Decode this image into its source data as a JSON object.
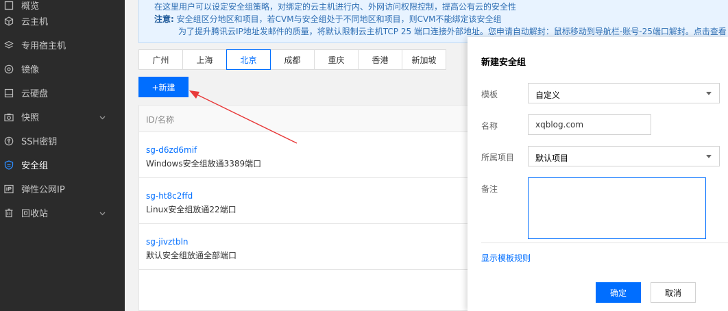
{
  "sidebar": {
    "items": [
      {
        "label": "概览",
        "icon": "overview-icon"
      },
      {
        "label": "云主机",
        "icon": "cube-icon"
      },
      {
        "label": "专用宿主机",
        "icon": "layers-icon"
      },
      {
        "label": "镜像",
        "icon": "disc-icon"
      },
      {
        "label": "云硬盘",
        "icon": "hard-disk-icon"
      },
      {
        "label": "快照",
        "icon": "camera-icon",
        "expandable": true
      },
      {
        "label": "SSH密钥",
        "icon": "key-icon"
      },
      {
        "label": "安全组",
        "icon": "shield-icon",
        "active": true
      },
      {
        "label": "弹性公网IP",
        "icon": "ip-icon"
      },
      {
        "label": "回收站",
        "icon": "trash-icon",
        "expandable": true
      }
    ]
  },
  "notice": {
    "line1": "在这里用户可以设定安全组策略，对绑定的云主机进行内、外网访问权限控制，提高公有云的安全性",
    "note_label": "注意:",
    "line2": "安全组区分地区和项目，若CVM与安全组处于不同地区和项目，则CVM不能绑定该安全组",
    "line3": "为了提升腾讯云IP地址发邮件的质量，将默认限制云主机TCP 25 端口连接外部地址。您申请自动解封：鼠标移动到导航栏-账号-25端口解封。点击查看"
  },
  "regions": [
    "广州",
    "上海",
    "北京",
    "成都",
    "重庆",
    "香港",
    "新加坡"
  ],
  "active_region": "北京",
  "new_button": "+新建",
  "table": {
    "header": "ID/名称",
    "rows": [
      {
        "id": "sg-d6zd6mif",
        "name": "Windows安全组放通3389端口"
      },
      {
        "id": "sg-ht8c2ffd",
        "name": "Linux安全组放通22端口"
      },
      {
        "id": "sg-jivztbln",
        "name": "默认安全组放通全部端口"
      }
    ]
  },
  "panel": {
    "title": "新建安全组",
    "template_label": "模板",
    "template_value": "自定义",
    "name_label": "名称",
    "name_value": "xqblog.com",
    "project_label": "所属项目",
    "project_value": "默认项目",
    "remark_label": "备注",
    "show_rules_link": "显示模板规则",
    "confirm": "确定",
    "cancel": "取消"
  },
  "colors": {
    "accent": "#006eff",
    "sidebar_bg": "#2b2b2b",
    "arrow": "#e83a3a"
  }
}
